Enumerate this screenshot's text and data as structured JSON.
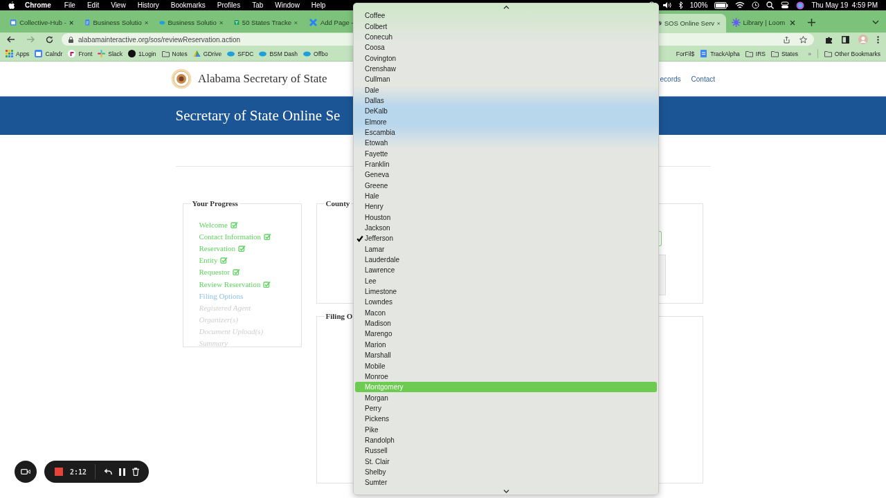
{
  "menu_bar": {
    "app": "Chrome",
    "items": [
      "File",
      "Edit",
      "View",
      "History",
      "Bookmarks",
      "Profiles",
      "Tab",
      "Window",
      "Help"
    ],
    "battery": "100%",
    "clock": "Thu May 19  4:59 PM"
  },
  "tabs": [
    {
      "title": "Collective-Hub -",
      "selected": false
    },
    {
      "title": "Business Solutio",
      "selected": false
    },
    {
      "title": "Business Solutio",
      "selected": false
    },
    {
      "title": "50 States Tracke",
      "selected": false
    },
    {
      "title": "Add Page -",
      "selected": false
    },
    {
      "title": "SOS Online Serv",
      "selected": true
    },
    {
      "title": "Library | Loom",
      "selected": false
    }
  ],
  "address_bar": {
    "url": "alabamainteractive.org/sos/reviewReservation.action"
  },
  "bookmarks": [
    {
      "label": "Apps",
      "kind": "apps"
    },
    {
      "label": "Calndr",
      "kind": "site"
    },
    {
      "label": "Front",
      "kind": "site"
    },
    {
      "label": "Slack",
      "kind": "site"
    },
    {
      "label": "1Login",
      "kind": "site"
    },
    {
      "label": "Notes",
      "kind": "folder"
    },
    {
      "label": "GDrive",
      "kind": "site"
    },
    {
      "label": "SFDC",
      "kind": "site"
    },
    {
      "label": "BSM Dash",
      "kind": "site"
    },
    {
      "label": "Offbo",
      "kind": "site"
    }
  ],
  "bookmarks_right": [
    {
      "label": "ForFil$",
      "kind": "text"
    },
    {
      "label": "TrackAlpha",
      "kind": "site"
    },
    {
      "label": "IRS",
      "kind": "folder"
    },
    {
      "label": "States",
      "kind": "folder"
    }
  ],
  "bookmarks_overflow": "»",
  "other_bookmarks": "Other Bookmarks",
  "site": {
    "title": "Alabama Secretary of State",
    "nav": [
      "ecords",
      "Contact"
    ],
    "banner": "Secretary of State Online Se",
    "progress": {
      "legend": "Your Progress",
      "steps": [
        {
          "label": "Welcome",
          "completed": true,
          "current": false
        },
        {
          "label": "Contact Information",
          "completed": true,
          "current": false
        },
        {
          "label": "Reservation",
          "completed": true,
          "current": false
        },
        {
          "label": "Entity",
          "completed": true,
          "current": false
        },
        {
          "label": "Requestor",
          "completed": true,
          "current": false
        },
        {
          "label": "Review Reservation",
          "completed": true,
          "current": false
        },
        {
          "label": "Filing Options",
          "completed": false,
          "current": true
        },
        {
          "label": "Registered Agent",
          "completed": false,
          "current": false
        },
        {
          "label": "Organizer(s)",
          "completed": false,
          "current": false
        },
        {
          "label": "Document Upload(s)",
          "completed": false,
          "current": false
        },
        {
          "label": "Summary",
          "completed": false,
          "current": false
        }
      ]
    },
    "sections": [
      "County",
      "Filing O"
    ]
  },
  "county_dropdown": {
    "options": [
      {
        "label": "Coffee",
        "selected": false,
        "highlighted": false
      },
      {
        "label": "Colbert",
        "selected": false,
        "highlighted": false
      },
      {
        "label": "Conecuh",
        "selected": false,
        "highlighted": false
      },
      {
        "label": "Coosa",
        "selected": false,
        "highlighted": false
      },
      {
        "label": "Covington",
        "selected": false,
        "highlighted": false
      },
      {
        "label": "Crenshaw",
        "selected": false,
        "highlighted": false
      },
      {
        "label": "Cullman",
        "selected": false,
        "highlighted": false
      },
      {
        "label": "Dale",
        "selected": false,
        "highlighted": false
      },
      {
        "label": "Dallas",
        "selected": false,
        "highlighted": false
      },
      {
        "label": "DeKalb",
        "selected": false,
        "highlighted": false
      },
      {
        "label": "Elmore",
        "selected": false,
        "highlighted": false
      },
      {
        "label": "Escambia",
        "selected": false,
        "highlighted": false
      },
      {
        "label": "Etowah",
        "selected": false,
        "highlighted": false
      },
      {
        "label": "Fayette",
        "selected": false,
        "highlighted": false
      },
      {
        "label": "Franklin",
        "selected": false,
        "highlighted": false
      },
      {
        "label": "Geneva",
        "selected": false,
        "highlighted": false
      },
      {
        "label": "Greene",
        "selected": false,
        "highlighted": false
      },
      {
        "label": "Hale",
        "selected": false,
        "highlighted": false
      },
      {
        "label": "Henry",
        "selected": false,
        "highlighted": false
      },
      {
        "label": "Houston",
        "selected": false,
        "highlighted": false
      },
      {
        "label": "Jackson",
        "selected": false,
        "highlighted": false
      },
      {
        "label": "Jefferson",
        "selected": true,
        "highlighted": false
      },
      {
        "label": "Lamar",
        "selected": false,
        "highlighted": false
      },
      {
        "label": "Lauderdale",
        "selected": false,
        "highlighted": false
      },
      {
        "label": "Lawrence",
        "selected": false,
        "highlighted": false
      },
      {
        "label": "Lee",
        "selected": false,
        "highlighted": false
      },
      {
        "label": "Limestone",
        "selected": false,
        "highlighted": false
      },
      {
        "label": "Lowndes",
        "selected": false,
        "highlighted": false
      },
      {
        "label": "Macon",
        "selected": false,
        "highlighted": false
      },
      {
        "label": "Madison",
        "selected": false,
        "highlighted": false
      },
      {
        "label": "Marengo",
        "selected": false,
        "highlighted": false
      },
      {
        "label": "Marion",
        "selected": false,
        "highlighted": false
      },
      {
        "label": "Marshall",
        "selected": false,
        "highlighted": false
      },
      {
        "label": "Mobile",
        "selected": false,
        "highlighted": false
      },
      {
        "label": "Monroe",
        "selected": false,
        "highlighted": false
      },
      {
        "label": "Montgomery",
        "selected": false,
        "highlighted": true
      },
      {
        "label": "Morgan",
        "selected": false,
        "highlighted": false
      },
      {
        "label": "Perry",
        "selected": false,
        "highlighted": false
      },
      {
        "label": "Pickens",
        "selected": false,
        "highlighted": false
      },
      {
        "label": "Pike",
        "selected": false,
        "highlighted": false
      },
      {
        "label": "Randolph",
        "selected": false,
        "highlighted": false
      },
      {
        "label": "Russell",
        "selected": false,
        "highlighted": false
      },
      {
        "label": "St. Clair",
        "selected": false,
        "highlighted": false
      },
      {
        "label": "Shelby",
        "selected": false,
        "highlighted": false
      },
      {
        "label": "Sumter",
        "selected": false,
        "highlighted": false
      }
    ]
  },
  "recorder": {
    "time": "2:12"
  }
}
